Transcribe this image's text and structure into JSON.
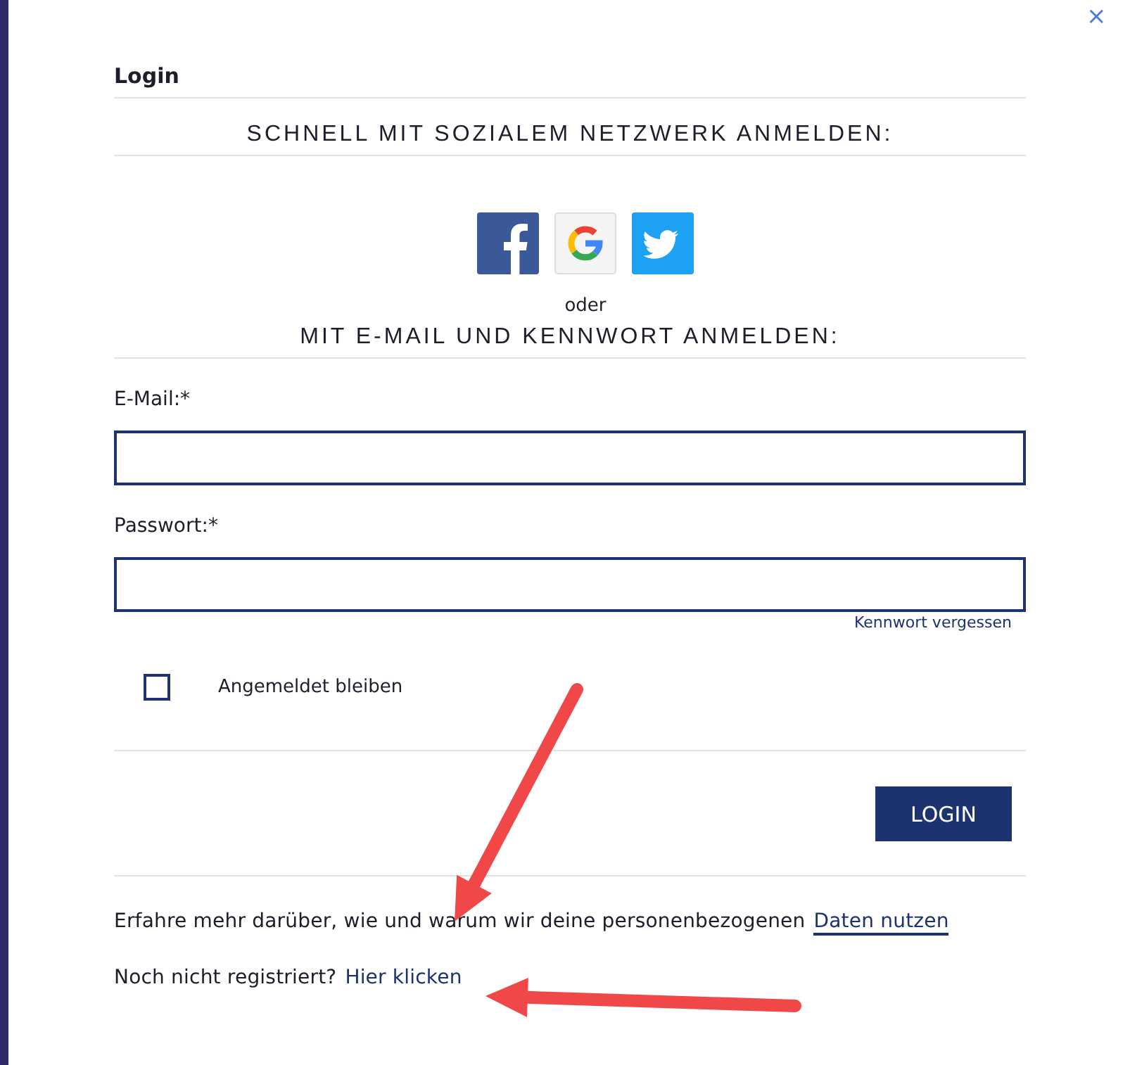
{
  "dialog": {
    "title": "Login",
    "close": "×"
  },
  "social": {
    "heading": "SCHNELL MIT SOZIALEM NETZWERK ANMELDEN:",
    "buttons": [
      {
        "kind": "facebook"
      },
      {
        "kind": "google"
      },
      {
        "kind": "twitter"
      }
    ],
    "separator": "oder"
  },
  "email_login": {
    "heading": "MIT E-MAIL UND KENNWORT ANMELDEN:",
    "fields": [
      {
        "label": "E-Mail:*"
      },
      {
        "label": "Passwort:*"
      }
    ],
    "forgot_link": "Kennwort vergessen",
    "remember": {
      "label": "Angemeldet bleiben",
      "checked": false
    },
    "submit": "LOGIN"
  },
  "footer": {
    "privacy_text": "Erfahre mehr darüber, wie und warum wir deine personenbezogenen",
    "privacy_link": "Daten nutzen",
    "register_text": "Noch nicht registriert?",
    "register_link": "Hier klicken"
  },
  "annotations": [
    {
      "kind": "arrow"
    },
    {
      "kind": "arrow"
    }
  ]
}
